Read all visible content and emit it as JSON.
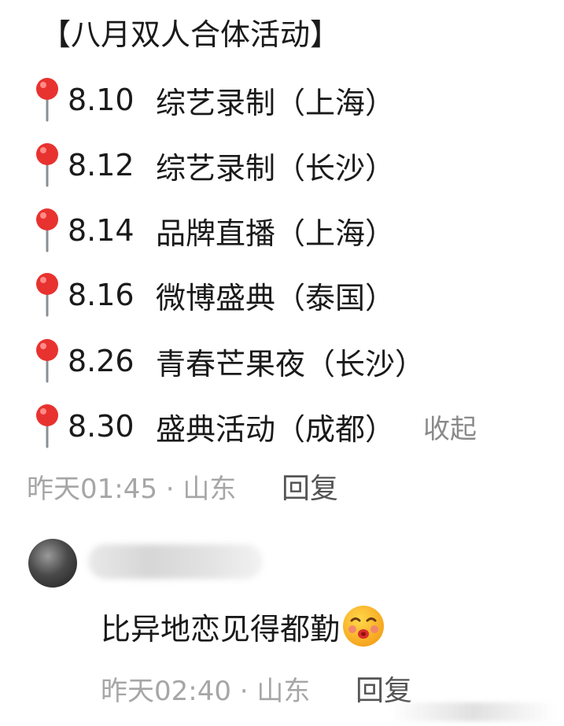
{
  "comment": {
    "title": "【八月双人合体活动】",
    "events": [
      {
        "date": "8.10",
        "text": "综艺录制（上海）"
      },
      {
        "date": "8.12",
        "text": "综艺录制（长沙）"
      },
      {
        "date": "8.14",
        "text": "品牌直播（上海）"
      },
      {
        "date": "8.16",
        "text": "微博盛典（泰国）"
      },
      {
        "date": "8.26",
        "text": "青春芒果夜（长沙）"
      },
      {
        "date": "8.30",
        "text": "盛典活动（成都）"
      }
    ],
    "collapse_label": "收起",
    "meta": "昨天01:45 · 山东",
    "reply_label": "回复"
  },
  "sub_reply": {
    "text": "比异地恋见得都勤",
    "meta": "昨天02:40 · 山东",
    "reply_label": "回复",
    "emoji": "kiss-face-emoji"
  },
  "icons": {
    "pin": "round-pushpin-icon",
    "pin_color": "#e8322f"
  }
}
